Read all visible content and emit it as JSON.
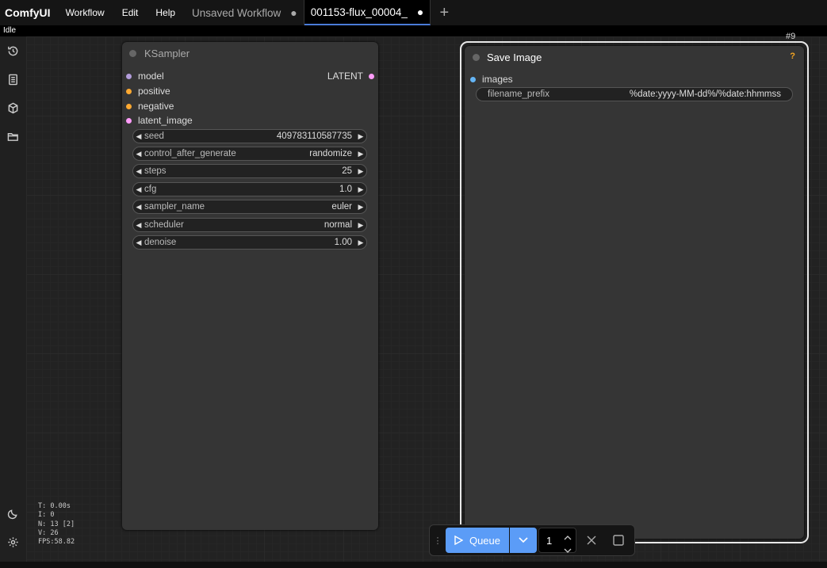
{
  "app": {
    "brand": "ComfyUI",
    "menu": [
      "Workflow",
      "Edit",
      "Help"
    ],
    "status": "Idle"
  },
  "tabs": [
    {
      "label": "Unsaved Workflow",
      "modified": "●",
      "active": false
    },
    {
      "label": "001153-flux_00004_",
      "modified": "●",
      "active": true
    }
  ],
  "tab_add": "+",
  "sidebar": {
    "icons": [
      "history-icon",
      "document-icon",
      "cube-icon",
      "folder-icon",
      "moon-icon",
      "gear-icon"
    ]
  },
  "ksampler": {
    "title": "KSampler",
    "inputs": [
      {
        "label": "model",
        "color": "#b39ddb"
      },
      {
        "label": "positive",
        "color": "#ffa931"
      },
      {
        "label": "negative",
        "color": "#ffa931"
      },
      {
        "label": "latent_image",
        "color": "#ff9cf9"
      }
    ],
    "output": {
      "label": "LATENT",
      "color": "#ff9cf9"
    },
    "widgets": [
      {
        "name": "seed",
        "value": "409783110587735"
      },
      {
        "name": "control_after_generate",
        "value": "randomize"
      },
      {
        "name": "steps",
        "value": "25"
      },
      {
        "name": "cfg",
        "value": "1.0"
      },
      {
        "name": "sampler_name",
        "value": "euler"
      },
      {
        "name": "scheduler",
        "value": "normal"
      },
      {
        "name": "denoise",
        "value": "1.00"
      }
    ]
  },
  "save_image": {
    "title": "Save Image",
    "badge": "#9",
    "help": "?",
    "input": {
      "label": "images",
      "color": "#64b5f6"
    },
    "filename_prefix": {
      "name": "filename_prefix",
      "value": "%date:yyyy-MM-dd%/%date:hhmmss"
    }
  },
  "queue": {
    "label": "Queue",
    "count": "1"
  },
  "stats": [
    "T: 0.00s",
    "I: 0",
    "N: 13 [2]",
    "V: 26",
    "FPS:58.82"
  ]
}
